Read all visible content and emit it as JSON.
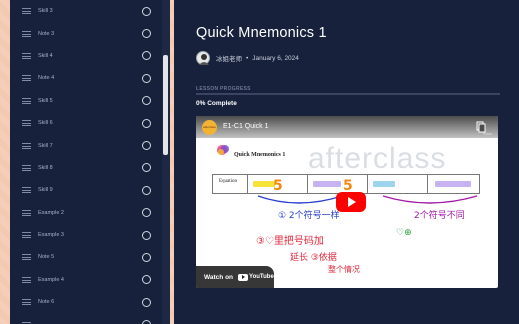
{
  "sidebar": {
    "items": [
      {
        "label": "Skill 3"
      },
      {
        "label": "Note 3"
      },
      {
        "label": "Skill 4"
      },
      {
        "label": "Note 4"
      },
      {
        "label": "Skill 5"
      },
      {
        "label": "Skill 6"
      },
      {
        "label": "Skill 7"
      },
      {
        "label": "Skill 8"
      },
      {
        "label": "Skill 9"
      },
      {
        "label": "Example 2"
      },
      {
        "label": "Example 3"
      },
      {
        "label": "Note 5"
      },
      {
        "label": "Example 4"
      },
      {
        "label": "Note 6"
      },
      {
        "label": ""
      }
    ]
  },
  "lesson": {
    "title": "Quick Mnemonics 1",
    "author": "冰姐老师",
    "separator": "•",
    "date": "January 6, 2024"
  },
  "progress": {
    "label": "LESSON PROGRESS",
    "text": "0% Complete",
    "fraction": 0
  },
  "video": {
    "title": "E1-C1 Quick 1",
    "channel_logo_text": "afterclass",
    "share_label": "Share",
    "board_title": "Quick Mnemonics 1",
    "watermark": "afterclass",
    "equation_label": "Equation",
    "eq_cells": [
      "+ ? = ",
      "− ? = ",
      "+ ? = ",
      "− ? + ? = "
    ],
    "handwriting": {
      "five1": "5",
      "five2": "5",
      "note1": "① 2个符号一样",
      "note2": "2个符号不同",
      "note3": "③♡里把号码加",
      "note4": "延长 ③依据",
      "note5": "整个情况",
      "heart": "♡⊕"
    },
    "watch_on": "Watch on",
    "youtube": "YouTube",
    "colors": {
      "play": "#ff0000",
      "highlight_yellow": "#f6e23a",
      "highlight_purple": "#c7b3f2",
      "highlight_blue": "#9fd4ef"
    }
  },
  "theme": {
    "sidebar_bg": "#17213c",
    "page_bg": "#f4c9b2",
    "text_light": "#ffffff"
  }
}
